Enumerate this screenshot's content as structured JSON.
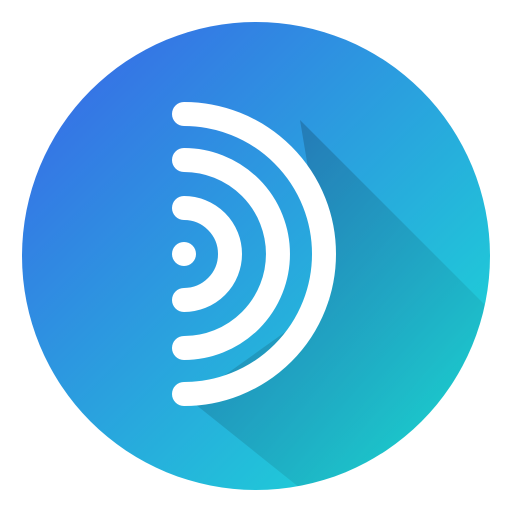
{
  "icon": {
    "name": "broadcast-signal-app-icon",
    "glyph": "signal-waves-icon",
    "colors": {
      "gradient_start": "#3a63e8",
      "gradient_end": "#19e2d4",
      "shadow": "#0b6fa8",
      "glyph": "#ffffff"
    }
  }
}
